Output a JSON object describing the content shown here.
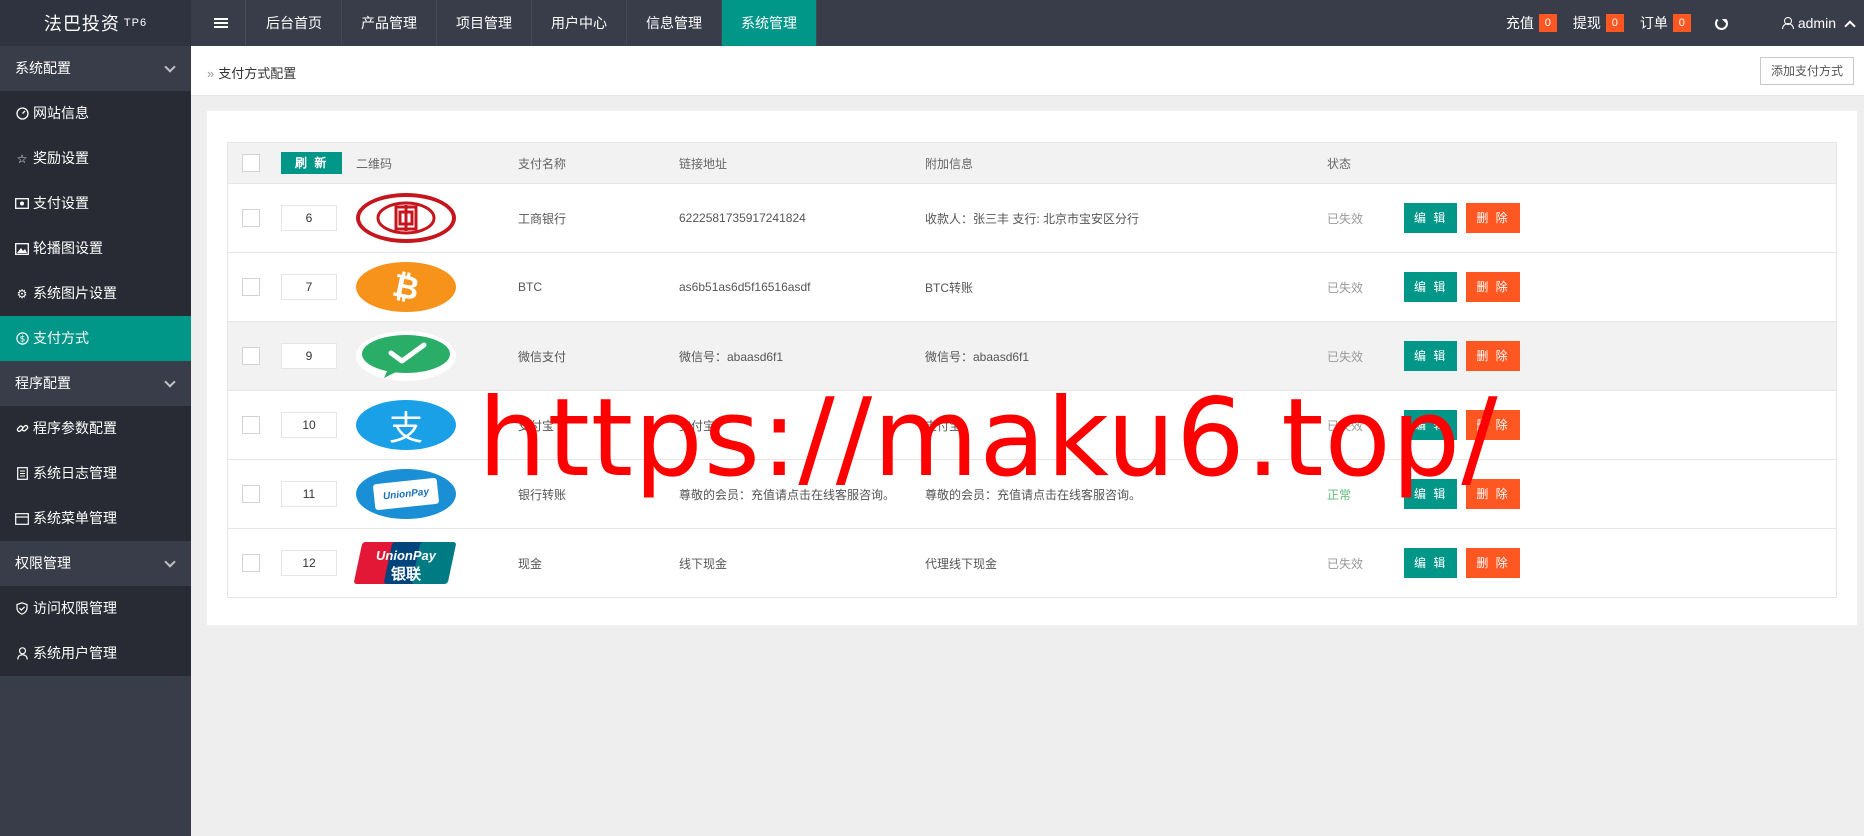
{
  "app": {
    "logo_text": "法巴投资",
    "logo_badge": "TP6"
  },
  "nav": {
    "items": [
      {
        "label": "后台首页",
        "active": false
      },
      {
        "label": "产品管理",
        "active": false
      },
      {
        "label": "项目管理",
        "active": false
      },
      {
        "label": "用户中心",
        "active": false
      },
      {
        "label": "信息管理",
        "active": false
      },
      {
        "label": "系统管理",
        "active": true
      }
    ]
  },
  "topright": {
    "recharge_label": "充值",
    "recharge_count": "0",
    "withdraw_label": "提现",
    "withdraw_count": "0",
    "order_label": "订单",
    "order_count": "0",
    "user_name": "admin"
  },
  "sidebar": {
    "groups": [
      {
        "label": "系统配置"
      },
      {
        "label": "程序配置"
      },
      {
        "label": "权限管理"
      }
    ],
    "items": [
      {
        "label": "网站信息",
        "icon": "dashboard-icon"
      },
      {
        "label": "奖励设置",
        "icon": "star-icon"
      },
      {
        "label": "支付设置",
        "icon": "money-icon"
      },
      {
        "label": "轮播图设置",
        "icon": "picture-icon"
      },
      {
        "label": "系统图片设置",
        "icon": "gear-icon"
      },
      {
        "label": "支付方式",
        "icon": "dollar-icon",
        "active": true
      },
      {
        "label": "程序参数配置",
        "icon": "link-icon"
      },
      {
        "label": "系统日志管理",
        "icon": "log-icon"
      },
      {
        "label": "系统菜单管理",
        "icon": "menu-icon"
      },
      {
        "label": "访问权限管理",
        "icon": "shield-icon"
      },
      {
        "label": "系统用户管理",
        "icon": "user-icon"
      }
    ]
  },
  "breadcrumb": {
    "current": "支付方式配置"
  },
  "toolbar": {
    "add_label": "添加支付方式"
  },
  "table": {
    "refresh_label": "刷 新",
    "headers": {
      "qr": "二维码",
      "name": "支付名称",
      "link": "链接地址",
      "extra": "附加信息",
      "status": "状态"
    },
    "edit_label": "编 辑",
    "delete_label": "删 除",
    "rows": [
      {
        "sort": "6",
        "logo": "icbc",
        "name": "工商银行",
        "link": "6222581735917241824",
        "extra": "收款人：张三丰 支行: 北京市宝安区分行",
        "status": "已失效",
        "active": false
      },
      {
        "sort": "7",
        "logo": "btc",
        "name": "BTC",
        "link": "as6b51as6d5f16516asdf",
        "extra": "BTC转账",
        "status": "已失效",
        "active": false
      },
      {
        "sort": "9",
        "logo": "wechat",
        "name": "微信支付",
        "link": "微信号：abaasd6f1",
        "extra": "微信号：abaasd6f1",
        "status": "已失效",
        "active": false
      },
      {
        "sort": "10",
        "logo": "alipay",
        "name": "支付宝",
        "link": "支付宝",
        "extra": "支付宝",
        "status": "已失效",
        "active": false
      },
      {
        "sort": "11",
        "logo": "unionpay-card",
        "name": "银行转账",
        "link": "尊敬的会员：充值请点击在线客服咨询。",
        "extra": "尊敬的会员：充值请点击在线客服咨询。",
        "status": "正常",
        "active": true
      },
      {
        "sort": "12",
        "logo": "unionpay",
        "name": "现金",
        "link": "线下现金",
        "extra": "代理线下现金",
        "status": "已失效",
        "active": false
      }
    ]
  },
  "watermark": "https://maku6.top/",
  "colors": {
    "topbar": "#393d49",
    "sidebar": "#282b33",
    "accent": "#009688",
    "danger": "#ff5722",
    "watermark": "#ff0000"
  }
}
